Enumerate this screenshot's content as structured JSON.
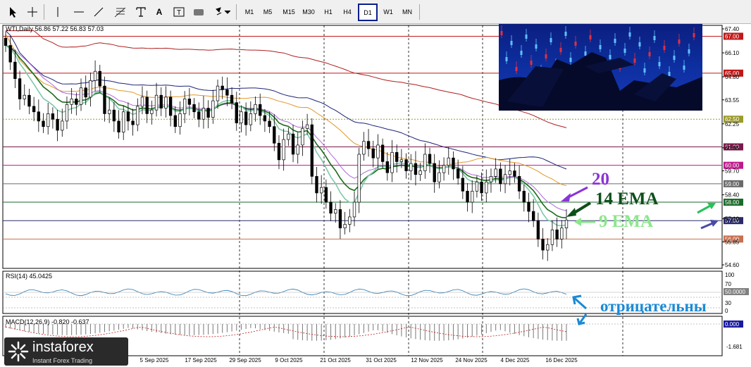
{
  "toolbar": {
    "tools": [
      "cursor-icon",
      "crosshair-icon",
      "vertical-line-icon",
      "horizontal-line-icon",
      "trend-line-icon",
      "fibonacci-icon",
      "text-icon",
      "label-icon",
      "shapes-icon",
      "arrows-icon"
    ],
    "tool_text": {
      "text": "A",
      "label": "T"
    },
    "timeframes": [
      "M1",
      "M5",
      "M15",
      "M30",
      "H1",
      "H4",
      "D1",
      "W1",
      "MN"
    ],
    "active_timeframe": "D1"
  },
  "chart": {
    "header": "WTI,Daily  56.86 57.22 56.83 57.03",
    "price_ticks": [
      "67.40",
      "66.10",
      "64.80",
      "63.55",
      "62.25",
      "60.95",
      "59.70",
      "58.40",
      "57.10",
      "55.85",
      "54.60"
    ],
    "level_badges": [
      {
        "text": "67.00",
        "price": 67.0,
        "color": "#c01818"
      },
      {
        "text": "65.00",
        "price": 65.0,
        "color": "#c01818"
      },
      {
        "text": "62.50",
        "price": 62.5,
        "color": "#9b9b2a"
      },
      {
        "text": "61.00",
        "price": 61.0,
        "color": "#7a1a4a"
      },
      {
        "text": "60.00",
        "price": 60.0,
        "color": "#c0188c"
      },
      {
        "text": "59.00",
        "price": 59.0,
        "color": "#6a6a6a"
      },
      {
        "text": "58.00",
        "price": 58.0,
        "color": "#1a6a2a"
      },
      {
        "text": "57.00",
        "price": 57.0,
        "color": "#2a2a6a"
      },
      {
        "text": "56.00",
        "price": 56.0,
        "color": "#c87050"
      }
    ],
    "date_labels": [
      "5 Sep 2025",
      "17 Sep 2025",
      "29 Sep 2025",
      "9 Oct 2025",
      "21 Oct 2025",
      "31 Oct 2025",
      "12 Nov 2025",
      "24 Nov 2025",
      "4 Dec 2025",
      "16 Dec 2025"
    ],
    "annotations": {
      "ema20": "20",
      "ema14": "14 EMA",
      "ema9": "9 EMA",
      "negative": "отрицательны"
    },
    "rsi": {
      "header": "RSI(14) 45.0425",
      "ticks": [
        "100",
        "70",
        "30",
        "0"
      ],
      "value_badge": "50.0000"
    },
    "macd": {
      "header": "MACD(12,26,9) -0.820 -0.637",
      "value_badge": "0.000",
      "low_tick": "-1.681"
    }
  },
  "logo": {
    "name": "instaforex",
    "tagline": "Instant Forex Trading"
  },
  "chart_data": {
    "type": "line",
    "title": "WTI,Daily",
    "x_labels": [
      "5 Sep 2025",
      "17 Sep 2025",
      "29 Sep 2025",
      "9 Oct 2025",
      "21 Oct 2025",
      "31 Oct 2025",
      "12 Nov 2025",
      "24 Nov 2025",
      "4 Dec 2025",
      "16 Dec 2025"
    ],
    "ylim": [
      54.6,
      67.4
    ],
    "close": [
      66.5,
      65.6,
      64.7,
      63.6,
      63.8,
      63.2,
      62.9,
      62.4,
      62.1,
      62.8,
      62.5,
      61.9,
      62.4,
      63.3,
      63.6,
      63.3,
      64.2,
      63.7,
      64.6,
      65.1,
      64.3,
      62.8,
      63.0,
      62.4,
      61.8,
      62.9,
      62.4,
      62.2,
      63.2,
      63.7,
      62.8,
      63.0,
      63.8,
      63.1,
      63.7,
      62.7,
      62.1,
      62.8,
      63.6,
      63.3,
      62.9,
      62.5,
      63.1,
      62.6,
      63.5,
      64.3,
      64.1,
      63.8,
      63.4,
      62.3,
      62.9,
      62.2,
      62.8,
      63.3,
      62.7,
      62.4,
      62.1,
      61.2,
      60.3,
      61.4,
      61.7,
      60.6,
      61.1,
      62.0,
      62.2,
      59.4,
      58.5,
      58.8,
      58.0,
      57.4,
      57.6,
      56.6,
      56.8,
      57.2,
      58.0,
      60.6,
      61.3,
      60.9,
      60.4,
      61.1,
      60.2,
      59.6,
      60.7,
      60.2,
      60.3,
      59.7,
      60.1,
      59.5,
      59.7,
      60.6,
      60.1,
      59.1,
      59.6,
      60.0,
      60.4,
      59.8,
      59.3,
      58.6,
      58.0,
      58.6,
      59.1,
      58.5,
      59.1,
      59.4,
      59.8,
      59.0,
      59.5,
      59.7,
      59.4,
      58.6,
      58.0,
      57.5,
      57.0,
      56.0,
      55.4,
      55.7,
      56.5,
      56.0,
      56.6,
      57.03
    ],
    "series": [
      {
        "name": "9 EMA",
        "color": "#7fc8a9"
      },
      {
        "name": "14 EMA",
        "color": "#1b6b1b"
      },
      {
        "name": "20",
        "color": "#b06ad8"
      },
      {
        "name": "",
        "color": "#e0982a"
      },
      {
        "name": "",
        "color": "#1c2475"
      },
      {
        "name": "",
        "color": "#b01d1d"
      }
    ],
    "rsi": {
      "ylim": [
        0,
        100
      ],
      "levels": [
        30,
        50,
        70
      ]
    },
    "macd": {
      "zero_line": 0,
      "low": -1.681
    }
  }
}
